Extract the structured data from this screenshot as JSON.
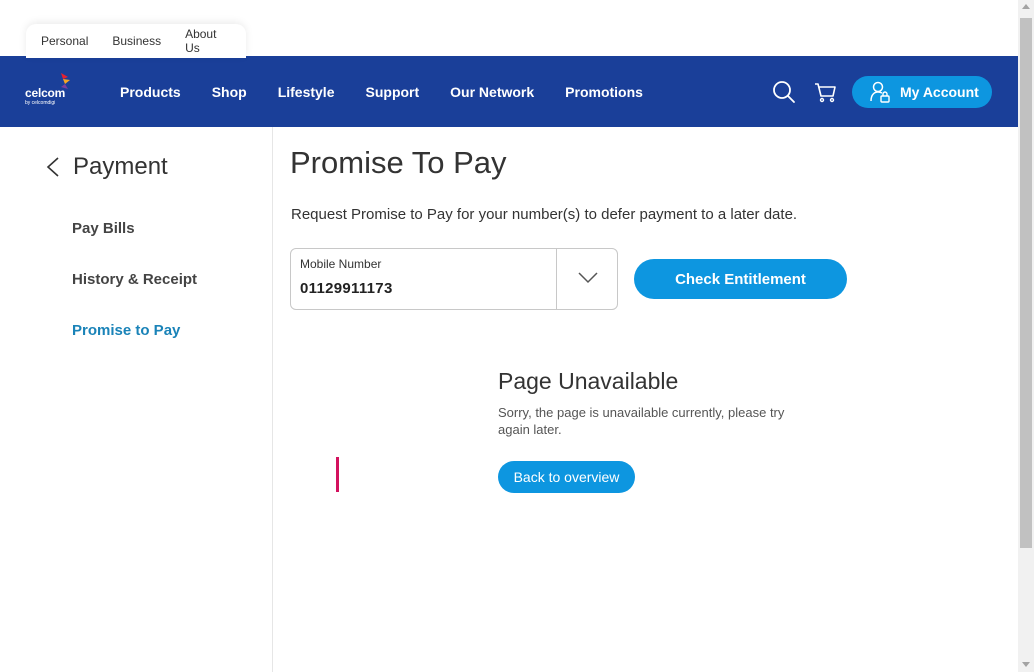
{
  "segments": [
    "Personal",
    "Business",
    "About Us"
  ],
  "brand": {
    "name": "celcom",
    "sub": "by celcomdigi"
  },
  "nav": [
    "Products",
    "Shop",
    "Lifestyle",
    "Support",
    "Our Network",
    "Promotions"
  ],
  "header": {
    "account_label": "My Account",
    "search_icon": "search-icon",
    "cart_icon": "cart-icon"
  },
  "sidebar": {
    "title": "Payment",
    "items": [
      {
        "label": "Pay Bills"
      },
      {
        "label": "History & Receipt"
      },
      {
        "label": "Promise to Pay"
      }
    ]
  },
  "main": {
    "title": "Promise To Pay",
    "description": "Request Promise to Pay for your number(s) to defer payment to a later date.",
    "mobile_label": "Mobile Number",
    "mobile_value": "01129911173",
    "check_button": "Check Entitlement"
  },
  "unavailable": {
    "title": "Page Unavailable",
    "message": "Sorry, the page is unavailable currently, please try again later.",
    "button": "Back to overview"
  },
  "colors": {
    "navbar": "#1a3f99",
    "primary": "#0d96e0",
    "active": "#1a83b8",
    "accent_red": "#d3125e"
  }
}
